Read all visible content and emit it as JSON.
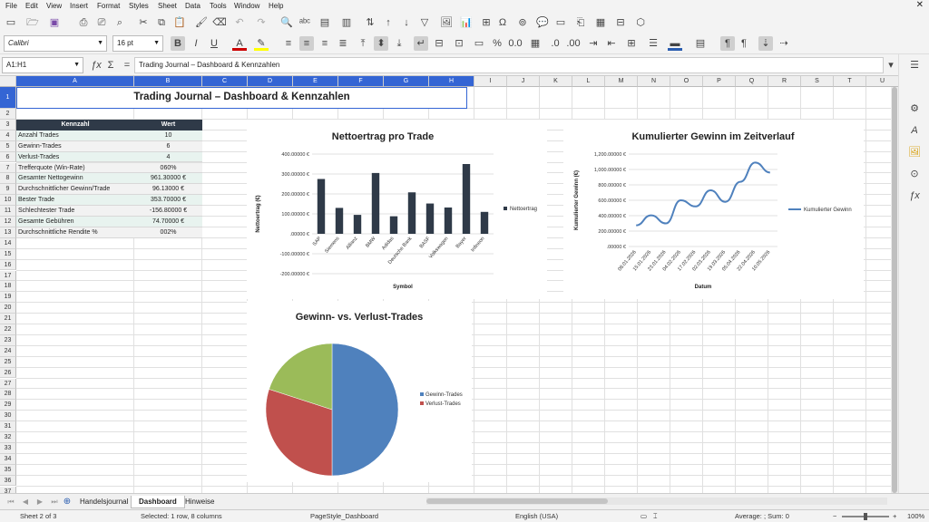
{
  "menu": [
    "File",
    "Edit",
    "View",
    "Insert",
    "Format",
    "Styles",
    "Sheet",
    "Data",
    "Tools",
    "Window",
    "Help"
  ],
  "toolbar": {
    "font_name": "Calibri",
    "font_size": "16 pt"
  },
  "formula_bar": {
    "cell_ref": "A1:H1",
    "content": "Trading Journal – Dashboard & Kennzahlen"
  },
  "columns": [
    "A",
    "B",
    "C",
    "D",
    "E",
    "F",
    "G",
    "H",
    "I",
    "J",
    "K",
    "L",
    "M",
    "N",
    "O",
    "P",
    "Q",
    "R",
    "S",
    "T",
    "U"
  ],
  "rows": [
    "1",
    "2",
    "3",
    "4",
    "5",
    "6",
    "7",
    "8",
    "9",
    "10",
    "11",
    "12",
    "13",
    "14",
    "15",
    "16",
    "17",
    "18",
    "19",
    "20",
    "21",
    "22",
    "23",
    "24",
    "25",
    "26",
    "27",
    "28",
    "29",
    "30",
    "31",
    "32",
    "33",
    "34",
    "35",
    "36",
    "37"
  ],
  "title": "Trading Journal – Dashboard & Kennzahlen",
  "kpi_table": {
    "header": [
      "Kennzahl",
      "Wert"
    ],
    "rows": [
      [
        "Anzahl Trades",
        "10"
      ],
      [
        "Gewinn-Trades",
        "6"
      ],
      [
        "Verlust-Trades",
        "4"
      ],
      [
        "Trefferquote (Win-Rate)",
        "060%"
      ],
      [
        "Gesamter Nettogewinn",
        "961.30000 €"
      ],
      [
        "Durchschnittlicher Gewinn/Trade",
        "96.13000 €"
      ],
      [
        "Bester Trade",
        "353.70000 €"
      ],
      [
        "Schlechtester Trade",
        "-156.80000 €"
      ],
      [
        "Gesamte Gebühren",
        "74.70000 €"
      ],
      [
        "Durchschnittliche Rendite %",
        "002%"
      ]
    ]
  },
  "chart_data": [
    {
      "type": "bar",
      "title": "Nettoertrag pro Trade",
      "xlabel": "Symbol",
      "ylabel": "Nettoertrag (€)",
      "categories": [
        "SAP",
        "Siemens",
        "Allianz",
        "BMW",
        "Adidas",
        "Deutsche Bank",
        "BASF",
        "Volkswagen",
        "Bayer",
        "Infineon"
      ],
      "series": [
        {
          "name": "Nettoertrag",
          "values": [
            275,
            130,
            95,
            305,
            88,
            208,
            152,
            132,
            350,
            110
          ]
        }
      ],
      "ylim": [
        -200,
        400
      ],
      "yticks": [
        "400.00000 €",
        "300.00000 €",
        "200.00000 €",
        "100.00000 €",
        ".00000 €",
        "-100.00000 €",
        "-200.00000 €"
      ],
      "color": "#2f3a48",
      "legend": "right",
      "grid": true
    },
    {
      "type": "line",
      "title": "Kumulierter Gewinn im Zeitverlauf",
      "xlabel": "Datum",
      "ylabel": "Kumulierter Gewinn (€)",
      "x": [
        "08.01.2026",
        "15.01.2026",
        "23.01.2026",
        "04.02.2026",
        "17.02.2026",
        "02.03.2026",
        "19.03.2026",
        "05.04.2026",
        "22.04.2026",
        "10.05.2026"
      ],
      "series": [
        {
          "name": "Kumulierter Gewinn",
          "values": [
            275,
            405,
            300,
            600,
            520,
            730,
            580,
            840,
            1090,
            961
          ]
        }
      ],
      "ylim": [
        0,
        1200
      ],
      "yticks": [
        "1,200.00000 €",
        "1,000.00000 €",
        "800.00000 €",
        "600.00000 €",
        "400.00000 €",
        "200.00000 €",
        ".00000 €"
      ],
      "color": "#4f81bd",
      "legend": "right",
      "grid": true
    },
    {
      "type": "pie",
      "title": "Gewinn- vs. Verlust-Trades",
      "categories": [
        "Gewinn-Trades",
        "Verlust-Trades"
      ],
      "values": [
        50,
        30
      ],
      "colors": [
        "#4f81bd",
        "#c0504d",
        "#9bbb59"
      ],
      "legend": "right"
    }
  ],
  "sheet_tabs": [
    "Handelsjournal",
    "Dashboard",
    "Hinweise"
  ],
  "active_tab": "Dashboard",
  "status": {
    "sheet": "Sheet 2 of 3",
    "selection": "Selected: 1 row, 8 columns",
    "pagestyle": "PageStyle_Dashboard",
    "language": "English (USA)",
    "summary": "Average: ; Sum: 0",
    "zoom": "100%"
  }
}
